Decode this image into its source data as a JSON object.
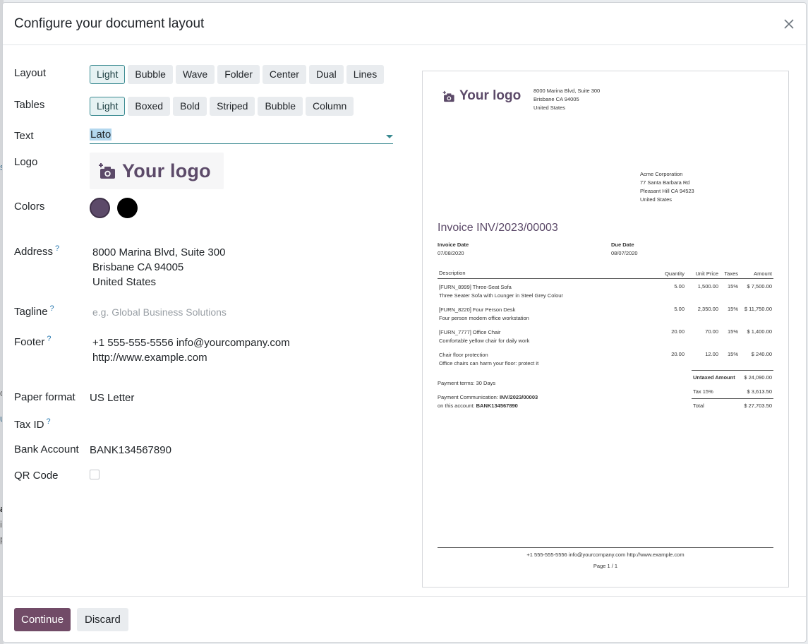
{
  "dialog": {
    "title": "Configure your document layout"
  },
  "form": {
    "layout_label": "Layout",
    "layout_options": [
      "Light",
      "Bubble",
      "Wave",
      "Folder",
      "Center",
      "Dual",
      "Lines"
    ],
    "layout_selected": "Light",
    "tables_label": "Tables",
    "tables_options": [
      "Light",
      "Boxed",
      "Bold",
      "Striped",
      "Bubble",
      "Column"
    ],
    "tables_selected": "Light",
    "text_label": "Text",
    "text_value": "Lato",
    "logo_label": "Logo",
    "logo_text": "Your logo",
    "colors_label": "Colors",
    "colors": [
      "#5c4a69",
      "#000000"
    ],
    "address_label": "Address",
    "address_lines": [
      "8000 Marina Blvd, Suite 300",
      "Brisbane CA 94005",
      "United States"
    ],
    "tagline_label": "Tagline",
    "tagline_placeholder": "e.g. Global Business Solutions",
    "footer_label": "Footer",
    "footer_lines": [
      "+1 555-555-5556 info@yourcompany.com",
      "http://www.example.com"
    ],
    "paper_format_label": "Paper format",
    "paper_format_value": "US Letter",
    "tax_id_label": "Tax ID",
    "bank_account_label": "Bank Account",
    "bank_account_value": "BANK134567890",
    "qr_code_label": "QR Code",
    "help_mark": "?"
  },
  "preview": {
    "logo_text": "Your logo",
    "company_address": [
      "8000 Marina Blvd, Suite 300",
      "Brisbane CA 94005",
      "United States"
    ],
    "customer_address": [
      "Acme Corporation",
      "77 Santa Barbara Rd",
      "Pleasant Hill CA 94523",
      "United States"
    ],
    "invoice_title": "Invoice INV/2023/00003",
    "invoice_date_label": "Invoice Date",
    "invoice_date": "07/08/2020",
    "due_date_label": "Due Date",
    "due_date": "08/07/2020",
    "columns": [
      "Description",
      "Quantity",
      "Unit Price",
      "Taxes",
      "Amount"
    ],
    "lines": [
      {
        "name": "[FURN_8999] Three-Seat Sofa",
        "desc": "Three Seater Sofa with Lounger in Steel Grey Colour",
        "qty": "5.00",
        "price": "1,500.00",
        "tax": "15%",
        "amount": "$ 7,500.00"
      },
      {
        "name": "[FURN_8220] Four Person Desk",
        "desc": "Four person modern office workstation",
        "qty": "5.00",
        "price": "2,350.00",
        "tax": "15%",
        "amount": "$ 11,750.00"
      },
      {
        "name": "[FURN_7777] Office Chair",
        "desc": "Comfortable yellow chair for daily work",
        "qty": "20.00",
        "price": "70.00",
        "tax": "15%",
        "amount": "$ 1,400.00"
      },
      {
        "name": "Chair floor protection",
        "desc": "Office chairs can harm your floor: protect it",
        "qty": "20.00",
        "price": "12.00",
        "tax": "15%",
        "amount": "$ 240.00"
      }
    ],
    "untaxed_label": "Untaxed Amount",
    "untaxed_value": "$ 24,090.00",
    "tax_label": "Tax 15%",
    "tax_value": "$ 3,613.50",
    "total_label": "Total",
    "total_value": "$ 27,703.50",
    "payment_terms": "Payment terms: 30 Days",
    "payment_comm_label": "Payment Communication:",
    "payment_comm_value": "INV/2023/00003",
    "account_label": "on this account:",
    "account_value": "BANK134567890",
    "footer": "+1 555-555-5556 info@yourcompany.com http://www.example.com",
    "page": "Page 1 / 1"
  },
  "actions": {
    "continue_label": "Continue",
    "discard_label": "Discard"
  },
  "background_fragments": [
    "s",
    "c",
    "u",
    "a",
    "i",
    "p"
  ]
}
